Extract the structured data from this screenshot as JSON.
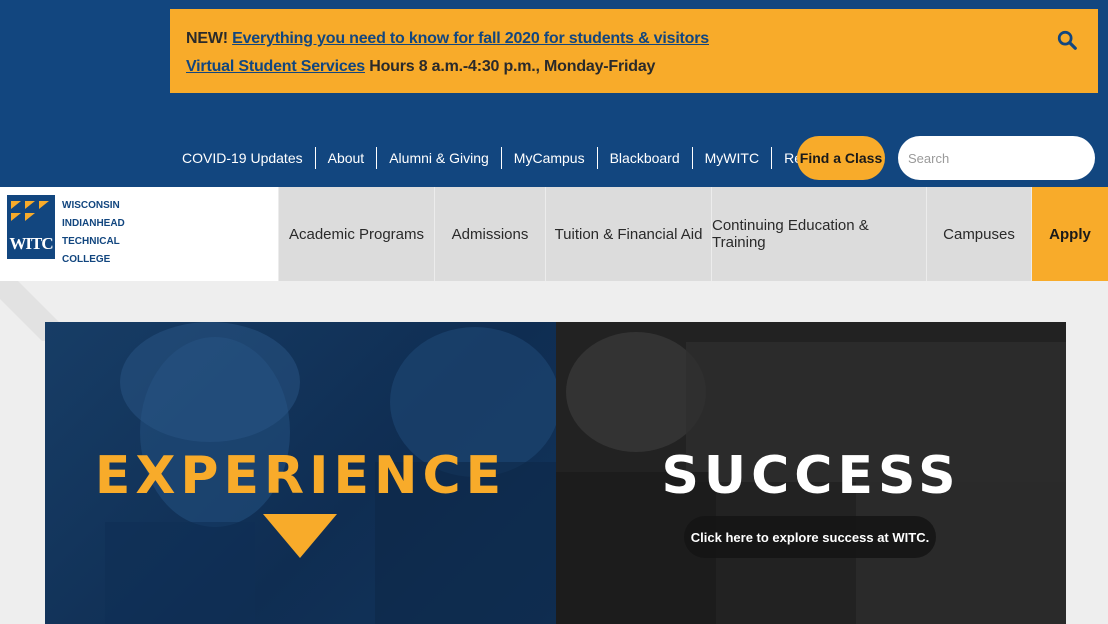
{
  "alert": {
    "new_label": "NEW!",
    "fall_link": "Everything you need to know for fall 2020 for students & visitors",
    "vss_link": "Virtual Student Services",
    "hours_text": "Hours 8 a.m.-4:30 p.m., Monday-Friday"
  },
  "utility_nav": {
    "items": [
      "COVID-19 Updates",
      "About",
      "Alumni & Giving",
      "MyCampus",
      "Blackboard",
      "MyWITC",
      "Request Info"
    ],
    "find_class": "Find a Class",
    "search_placeholder": "Search"
  },
  "logo": {
    "mark_text": "WITC",
    "lines": [
      "WISCONSIN",
      "INDIANHEAD",
      "TECHNICAL",
      "COLLEGE"
    ]
  },
  "main_nav": {
    "items": [
      "Academic Programs",
      "Admissions",
      "Tuition & Financial Aid",
      "Continuing Education & Training",
      "Campuses"
    ],
    "apply": "Apply"
  },
  "hero": {
    "left_headline": "EXPERIENCE",
    "right_headline": "SUCCESS",
    "right_cta": "Click here to explore success at WITC."
  },
  "colors": {
    "brand_blue": "#12467f",
    "brand_gold": "#f8ab2a"
  },
  "icons": {
    "search": "search-icon",
    "arrow": "triangle-down-icon"
  }
}
